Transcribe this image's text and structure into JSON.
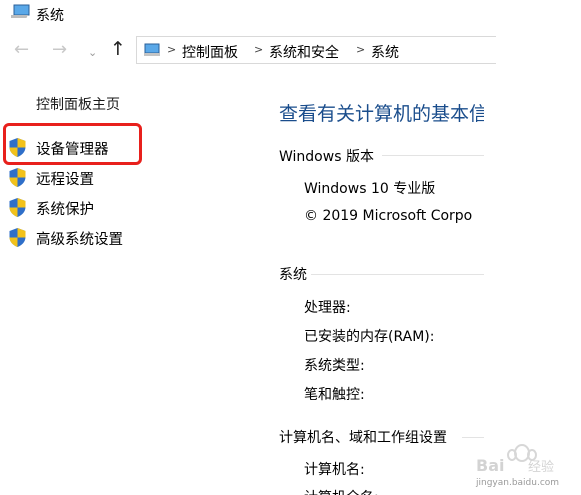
{
  "window": {
    "title": "系统"
  },
  "nav": {
    "back_glyph": "←",
    "forward_glyph": "→",
    "dropdown_glyph": "⌄",
    "up_glyph": "↑"
  },
  "address_bar": {
    "separator": ">",
    "crumbs": [
      "控制面板",
      "系统和安全",
      "系统"
    ]
  },
  "sidebar": {
    "home_link": "控制面板主页",
    "items": [
      {
        "label": "设备管理器",
        "icon": "shield-icon",
        "highlighted": true
      },
      {
        "label": "远程设置",
        "icon": "shield-icon"
      },
      {
        "label": "系统保护",
        "icon": "shield-icon"
      },
      {
        "label": "高级系统设置",
        "icon": "shield-icon"
      }
    ]
  },
  "main": {
    "heading": "查看有关计算机的基本信",
    "windows_edition": {
      "title": "Windows 版本",
      "edition": "Windows 10 专业版",
      "copyright": "© 2019 Microsoft Corpo"
    },
    "system": {
      "title": "系统",
      "processor_label": "处理器:",
      "ram_label": "已安装的内存(RAM):",
      "type_label": "系统类型:",
      "pen_label": "笔和触控:"
    },
    "computer_name": {
      "title": "计算机名、域和工作组设置",
      "name_label": "计算机名:",
      "full_name_label": "计算机全名:"
    }
  },
  "watermark": {
    "text": "jingyan.baidu.com",
    "logo_text": "Bai 经验"
  },
  "colors": {
    "heading": "#1a4d8c",
    "highlight": "#e8201c",
    "shield_blue": "#2f6fc9",
    "shield_yellow": "#f2c21b"
  }
}
